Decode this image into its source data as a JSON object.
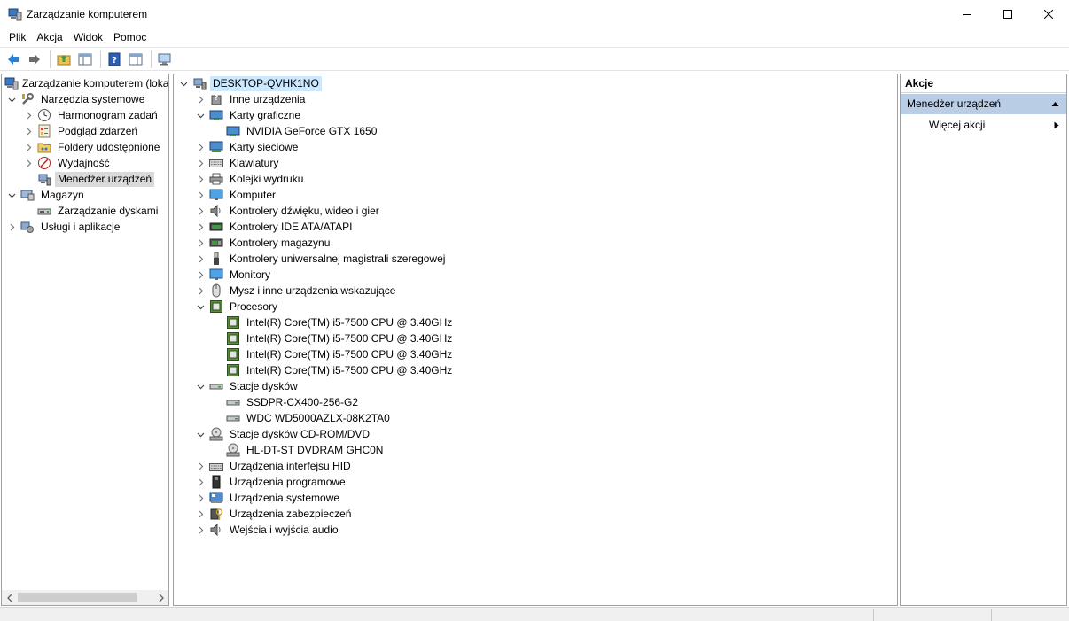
{
  "window": {
    "title": "Zarządzanie komputerem"
  },
  "menu": [
    {
      "label": "Plik"
    },
    {
      "label": "Akcja"
    },
    {
      "label": "Widok"
    },
    {
      "label": "Pomoc"
    }
  ],
  "left_tree": {
    "root": "Zarządzanie komputerem (loka",
    "items": [
      {
        "label": "Narzędzia systemowe"
      },
      {
        "label": "Harmonogram zadań"
      },
      {
        "label": "Podgląd zdarzeń"
      },
      {
        "label": "Foldery udostępnione"
      },
      {
        "label": "Wydajność"
      },
      {
        "label": "Menedżer urządzeń"
      },
      {
        "label": "Magazyn"
      },
      {
        "label": "Zarządzanie dyskami"
      },
      {
        "label": "Usługi i aplikacje"
      }
    ]
  },
  "device_tree": {
    "root": "DESKTOP-QVHK1NO",
    "rows": [
      {
        "label": "Inne urządzenia"
      },
      {
        "label": "Karty graficzne"
      },
      {
        "label": "NVIDIA GeForce GTX 1650"
      },
      {
        "label": "Karty sieciowe"
      },
      {
        "label": "Klawiatury"
      },
      {
        "label": "Kolejki wydruku"
      },
      {
        "label": "Komputer"
      },
      {
        "label": "Kontrolery dźwięku, wideo i gier"
      },
      {
        "label": "Kontrolery IDE ATA/ATAPI"
      },
      {
        "label": "Kontrolery magazynu"
      },
      {
        "label": "Kontrolery uniwersalnej magistrali szeregowej"
      },
      {
        "label": "Monitory"
      },
      {
        "label": "Mysz i inne urządzenia wskazujące"
      },
      {
        "label": "Procesory"
      },
      {
        "label": "Intel(R) Core(TM) i5-7500 CPU @ 3.40GHz"
      },
      {
        "label": "Intel(R) Core(TM) i5-7500 CPU @ 3.40GHz"
      },
      {
        "label": "Intel(R) Core(TM) i5-7500 CPU @ 3.40GHz"
      },
      {
        "label": "Intel(R) Core(TM) i5-7500 CPU @ 3.40GHz"
      },
      {
        "label": "Stacje dysków"
      },
      {
        "label": "SSDPR-CX400-256-G2"
      },
      {
        "label": "WDC WD5000AZLX-08K2TA0"
      },
      {
        "label": "Stacje dysków CD-ROM/DVD"
      },
      {
        "label": "HL-DT-ST DVDRAM GHC0N"
      },
      {
        "label": "Urządzenia interfejsu HID"
      },
      {
        "label": "Urządzenia programowe"
      },
      {
        "label": "Urządzenia systemowe"
      },
      {
        "label": "Urządzenia zabezpieczeń"
      },
      {
        "label": "Wejścia i wyjścia audio"
      }
    ]
  },
  "actions": {
    "header": "Akcje",
    "section": "Menedżer urządzeń",
    "more": "Więcej akcji"
  }
}
